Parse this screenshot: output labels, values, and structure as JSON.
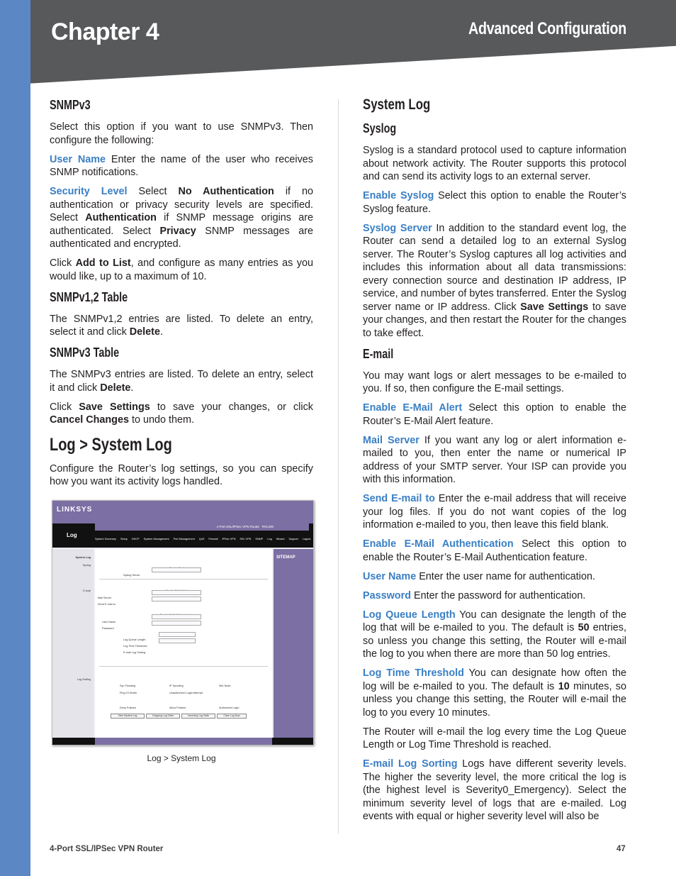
{
  "header": {
    "chapter": "Chapter 4",
    "section": "Advanced Configuration"
  },
  "colors": {
    "accent": "#3a7fc4",
    "stripe": "#5b87c5",
    "header_bg": "#58595b"
  },
  "left": [
    {
      "type": "h3",
      "text": "SNMPv3"
    },
    {
      "type": "p",
      "seg": [
        {
          "t": "Select this option if you want to use SNMPv3. Then configure the following:"
        }
      ]
    },
    {
      "type": "p",
      "seg": [
        {
          "t": "User Name",
          "s": "term"
        },
        {
          "t": " Enter the name of the user who receives SNMP notifications."
        }
      ]
    },
    {
      "type": "p",
      "seg": [
        {
          "t": "Security Level",
          "s": "term"
        },
        {
          "t": " Select "
        },
        {
          "t": "No Authentication",
          "s": "b"
        },
        {
          "t": " if no authentication or privacy security levels are specified. Select "
        },
        {
          "t": "Authentication",
          "s": "b"
        },
        {
          "t": " if SNMP message origins are authenticated. Select "
        },
        {
          "t": "Privacy",
          "s": "b"
        },
        {
          "t": " SNMP messages are authenticated and encrypted."
        }
      ]
    },
    {
      "type": "p",
      "seg": [
        {
          "t": "Click "
        },
        {
          "t": "Add to List",
          "s": "b"
        },
        {
          "t": ", and configure as many entries as you would like, up to a maximum of 10."
        }
      ]
    },
    {
      "type": "h3",
      "text": "SNMPv1,2 Table"
    },
    {
      "type": "p",
      "seg": [
        {
          "t": "The SNMPv1,2 entries are listed. To delete an entry, select it and click "
        },
        {
          "t": "Delete",
          "s": "b"
        },
        {
          "t": "."
        }
      ]
    },
    {
      "type": "h3",
      "text": "SNMPv3 Table"
    },
    {
      "type": "p",
      "seg": [
        {
          "t": "The SNMPv3 entries are listed. To delete an entry, select it and click "
        },
        {
          "t": "Delete",
          "s": "b"
        },
        {
          "t": "."
        }
      ]
    },
    {
      "type": "p",
      "seg": [
        {
          "t": "Click "
        },
        {
          "t": "Save Settings",
          "s": "b"
        },
        {
          "t": " to save your changes, or click "
        },
        {
          "t": "Cancel Changes",
          "s": "b"
        },
        {
          "t": " to undo them."
        }
      ]
    },
    {
      "type": "h2",
      "text": "Log > System Log"
    },
    {
      "type": "p",
      "seg": [
        {
          "t": "Configure the Router’s log settings, so you can specify how you want its activity logs handled."
        }
      ]
    }
  ],
  "figure": {
    "logo": "LINKSYS",
    "page_title": "Log",
    "product": "4 Port SSL/IPSec VPN Router",
    "model": "RVL200",
    "tabs": [
      "System Summary",
      "Setup",
      "DHCP",
      "System Management",
      "Port Management",
      "QoS",
      "Firewall",
      "IPSec VPN",
      "SSL VPN",
      "SNMP",
      "Log",
      "Wizard",
      "Support",
      "Logout"
    ],
    "sections": [
      "System Log",
      "Syslog",
      "E-mail",
      "Log Setting"
    ],
    "fields": [
      "Enable Syslog",
      "Syslog Server",
      "Enable E-Mail Alert",
      "Mail Server",
      "Send E-mail to",
      "Enable E-Mail Authentication",
      "User Name",
      "Password",
      "Log Queue Length",
      "Log Time Threshold",
      "E-mail Log Sorting"
    ],
    "checks": [
      "Syn Flooding",
      "IP Spoofing",
      "Win Nuke",
      "Ping Of Death",
      "Unauthorized Login Attempt",
      "Deny Policies",
      "Allow Policies",
      "Authorized Login"
    ],
    "buttons": [
      "View System Log",
      "Outgoing Log Table",
      "Incoming Log Table",
      "Clear Log Now"
    ],
    "sitemap": "SITEMAP",
    "bottom_buttons": [
      "Save Settings",
      "Cancel Changes"
    ],
    "caption": "Log > System Log"
  },
  "right": [
    {
      "type": "h3",
      "cls": "big",
      "text": "System Log"
    },
    {
      "type": "h3",
      "text": "Syslog"
    },
    {
      "type": "p",
      "seg": [
        {
          "t": "Syslog is a standard protocol used to capture information about network activity. The Router supports this protocol and can send its activity logs to an external server."
        }
      ]
    },
    {
      "type": "p",
      "seg": [
        {
          "t": "Enable Syslog",
          "s": "term"
        },
        {
          "t": " Select this option to enable the Router’s Syslog feature."
        }
      ]
    },
    {
      "type": "p",
      "seg": [
        {
          "t": "Syslog Server",
          "s": "term"
        },
        {
          "t": " In addition to the standard event log, the Router can send a detailed log to an external Syslog server. The Router’s Syslog captures all log activities and includes this information about all data transmissions: every connection source and destination IP address, IP service, and number of bytes transferred. Enter the Syslog server name or IP address. Click "
        },
        {
          "t": "Save Settings",
          "s": "b"
        },
        {
          "t": " to save your changes, and then restart the Router for the changes to take effect."
        }
      ]
    },
    {
      "type": "h3",
      "text": "E-mail"
    },
    {
      "type": "p",
      "seg": [
        {
          "t": "You may want logs or alert messages to be e-mailed to you. If so, then configure the E-mail settings."
        }
      ]
    },
    {
      "type": "p",
      "seg": [
        {
          "t": "Enable E-Mail Alert",
          "s": "term"
        },
        {
          "t": " Select this option to enable the Router’s E-Mail Alert feature."
        }
      ]
    },
    {
      "type": "p",
      "seg": [
        {
          "t": "Mail Server",
          "s": "term"
        },
        {
          "t": " If you want any log or alert information e-mailed to you, then enter the name or numerical IP address of your SMTP server. Your ISP can provide you with this information."
        }
      ]
    },
    {
      "type": "p",
      "seg": [
        {
          "t": "Send E-mail to",
          "s": "term"
        },
        {
          "t": " Enter the e-mail address that will receive your log files. If you do not want copies of the log information e-mailed to you, then leave this field blank."
        }
      ]
    },
    {
      "type": "p",
      "seg": [
        {
          "t": "Enable E-Mail Authentication",
          "s": "term"
        },
        {
          "t": " Select this option to enable the Router’s E-Mail Authentication feature."
        }
      ]
    },
    {
      "type": "p",
      "seg": [
        {
          "t": "User Name",
          "s": "term"
        },
        {
          "t": " Enter the user name for authentication."
        }
      ]
    },
    {
      "type": "p",
      "seg": [
        {
          "t": "Password",
          "s": "term"
        },
        {
          "t": " Enter the password for authentication."
        }
      ]
    },
    {
      "type": "p",
      "seg": [
        {
          "t": "Log Queue Length",
          "s": "term"
        },
        {
          "t": " You can designate the length of the log that will be e-mailed to you. The default is "
        },
        {
          "t": "50",
          "s": "b"
        },
        {
          "t": " entries, so unless you change this setting, the Router will e-mail the log to you when there are more than 50 log entries."
        }
      ]
    },
    {
      "type": "p",
      "seg": [
        {
          "t": "Log Time Threshold",
          "s": "term"
        },
        {
          "t": " You can designate how often the log will be e-mailed to you. The default is "
        },
        {
          "t": "10",
          "s": "b"
        },
        {
          "t": " minutes, so unless you change this setting, the Router will e-mail the log to you every 10 minutes."
        }
      ]
    },
    {
      "type": "p",
      "seg": [
        {
          "t": "The Router will e-mail the log every time the Log Queue Length or Log Time Threshold is reached."
        }
      ]
    },
    {
      "type": "p",
      "seg": [
        {
          "t": "E-mail Log Sorting",
          "s": "term"
        },
        {
          "t": " Logs have different severity levels. The higher the severity level, the more critical the log is (the highest level is Severity0_Emergency). Select the minimum severity level of logs that are e-mailed. Log events with equal or higher severity level will also be"
        }
      ]
    }
  ],
  "footer": {
    "product": "4-Port SSL/IPSec VPN Router",
    "page": "47"
  }
}
